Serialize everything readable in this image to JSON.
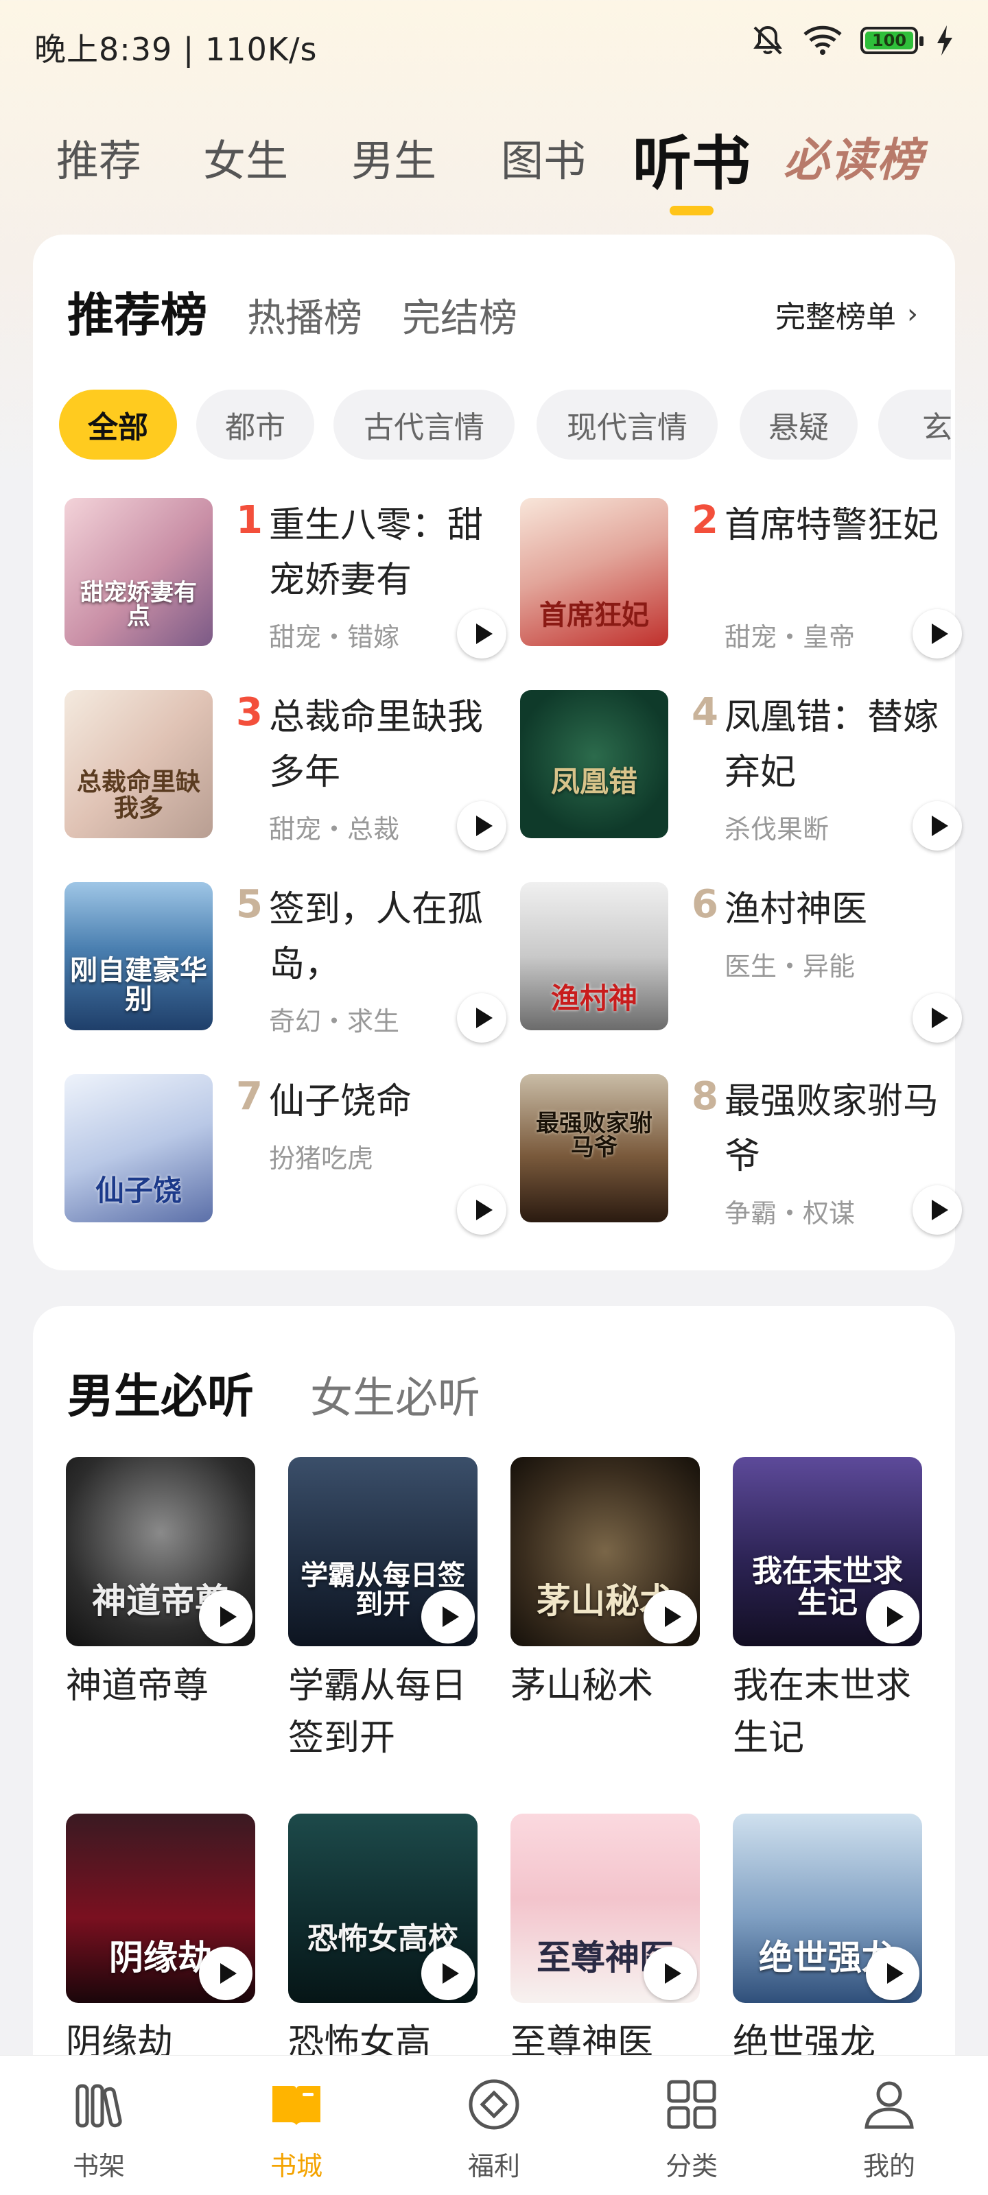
{
  "status": {
    "left": "晚上8:39 | 110K/s",
    "battery": "100"
  },
  "top_tabs": [
    "推荐",
    "女生",
    "男生",
    "图书",
    "听书",
    "必读榜"
  ],
  "rank": {
    "tabs": [
      "推荐榜",
      "热播榜",
      "完结榜"
    ],
    "full_list": "完整榜单",
    "chips": [
      "全部",
      "都市",
      "古代言情",
      "现代言情",
      "悬疑",
      "玄"
    ],
    "books": [
      {
        "rank": "1",
        "title": "重生八零：甜宠娇妻有",
        "tags": "甜宠・错嫁",
        "cover_text": "甜宠娇妻有点"
      },
      {
        "rank": "2",
        "title": "首席特警狂妃",
        "tags": "甜宠・皇帝",
        "cover_text": "首席狂妃"
      },
      {
        "rank": "3",
        "title": "总裁命里缺我多年",
        "tags": "甜宠・总裁",
        "cover_text": "总裁命里缺我多"
      },
      {
        "rank": "4",
        "title": "凤凰错：替嫁弃妃",
        "tags": "杀伐果断",
        "cover_text": "凤凰错"
      },
      {
        "rank": "5",
        "title": "签到，人在孤岛，",
        "tags": "奇幻・求生",
        "cover_text": "刚自建豪华别"
      },
      {
        "rank": "6",
        "title": "渔村神医",
        "tags": "医生・异能",
        "cover_text": "渔村神"
      },
      {
        "rank": "7",
        "title": "仙子饶命",
        "tags": "扮猪吃虎",
        "cover_text": "仙子饶"
      },
      {
        "rank": "8",
        "title": "最强败家驸马爷",
        "tags": "争霸・权谋",
        "cover_text": "最强败家驸马爷"
      }
    ]
  },
  "listen": {
    "tabs": [
      "男生必听",
      "女生必听"
    ],
    "items": [
      {
        "title": "神道帝尊",
        "cover_text": "神道帝尊"
      },
      {
        "title": "学霸从每日签到开",
        "cover_text": "学霸从每日签到开"
      },
      {
        "title": "茅山秘术",
        "cover_text": "茅山秘术"
      },
      {
        "title": "我在末世求生记",
        "cover_text": "我在末世求生记"
      },
      {
        "title": "阴缘劫",
        "cover_text": "阴缘劫"
      },
      {
        "title": "恐怖女高",
        "cover_text": "恐怖女高校"
      },
      {
        "title": "至尊神医",
        "cover_text": "至尊神医"
      },
      {
        "title": "绝世强龙",
        "cover_text": "绝世强龙"
      }
    ]
  },
  "bottom_nav": [
    {
      "label": "书架",
      "icon": "bookshelf-icon"
    },
    {
      "label": "书城",
      "icon": "bookstore-icon"
    },
    {
      "label": "福利",
      "icon": "welfare-icon"
    },
    {
      "label": "分类",
      "icon": "category-icon"
    },
    {
      "label": "我的",
      "icon": "profile-icon"
    }
  ],
  "colors": {
    "accent": "#ffc419",
    "rank_hot": "#f34f3b",
    "rank_normal": "#c9b39a",
    "active_nav": "#f4a300"
  }
}
